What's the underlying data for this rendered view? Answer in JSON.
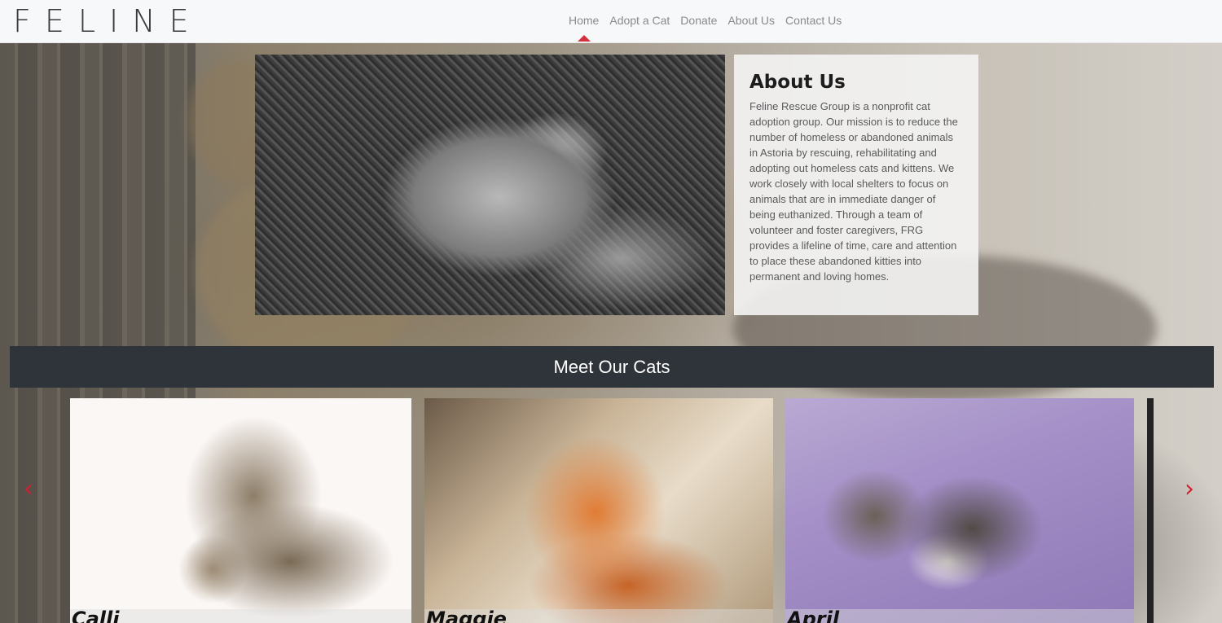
{
  "header": {
    "logo": "FELINE",
    "nav": [
      {
        "label": "Home",
        "active": true
      },
      {
        "label": "Adopt a Cat",
        "active": false
      },
      {
        "label": "Donate",
        "active": false
      },
      {
        "label": "About Us",
        "active": false
      },
      {
        "label": "Contact Us",
        "active": false
      }
    ]
  },
  "about": {
    "title": "About Us",
    "text": "Feline Rescue Group is a nonprofit cat adoption group. Our mission is to reduce the number of homeless or abandoned animals in Astoria by rescuing, rehabilitating and adopting out homeless cats and kittens. We work closely with local shelters to focus on animals that are in immediate danger of being euthanized. Through a team of volunteer and foster caregivers, FRG provides a lifeline of time, care and attention to place these abandoned kitties into permanent and loving homes."
  },
  "cats": {
    "heading": "Meet Our Cats",
    "items": [
      {
        "name": "Calli"
      },
      {
        "name": "Maggie"
      },
      {
        "name": "April"
      }
    ],
    "prev_icon": "‹",
    "next_icon": "›"
  },
  "colors": {
    "accent": "#d6303f",
    "bar": "#2f343b",
    "arrow": "#d21f2b"
  }
}
